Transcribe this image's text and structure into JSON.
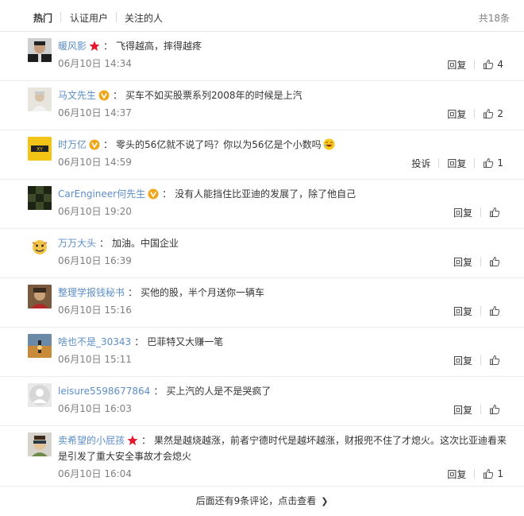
{
  "tabs": {
    "hot": "热门",
    "verified": "认证用户",
    "following": "关注的人",
    "total": "共18条"
  },
  "colors": {
    "username": "#eb7350",
    "username_blue": "#5c8ec8",
    "badge_gold": "#f0a71a",
    "badge_red": "#e6162d",
    "muted": "#808080"
  },
  "comments": [
    {
      "user": "暖风影",
      "badge": "red-star-icon",
      "text": "飞得越高，摔得越疼",
      "time": "06月10日 14:34",
      "report": "",
      "reply": "回复",
      "likes": "4"
    },
    {
      "user": "马文先生",
      "badge": "gold-v-icon",
      "text": "买车不如买股票系列2008年的时候是上汽",
      "time": "06月10日 14:37",
      "report": "",
      "reply": "回复",
      "likes": "2"
    },
    {
      "user": "时万亿",
      "badge": "gold-v-icon",
      "text": "零头的56亿就不说了吗？你以为56亿是个小数吗",
      "time": "06月10日 14:59",
      "report": "投诉",
      "reply": "回复",
      "likes": "1"
    },
    {
      "user": "CarEngineer何先生",
      "badge": "gold-v-icon",
      "text": "没有人能挡住比亚迪的发展了，除了他自己",
      "time": "06月10日 19:20",
      "report": "",
      "reply": "回复",
      "likes": ""
    },
    {
      "user": "万万大头",
      "badge": "",
      "text": "加油。中国企业",
      "time": "06月10日 16:39",
      "report": "",
      "reply": "回复",
      "likes": ""
    },
    {
      "user": "整理学报钱秘书",
      "badge": "",
      "text": "买他的股，半个月送你一辆车",
      "time": "06月10日 15:16",
      "report": "",
      "reply": "回复",
      "likes": ""
    },
    {
      "user": "啥也不是_30343",
      "badge": "",
      "text": "巴菲特又大赚一笔",
      "time": "06月10日 15:11",
      "report": "",
      "reply": "回复",
      "likes": ""
    },
    {
      "user": "leisure5598677864",
      "badge": "",
      "text": "买上汽的人是不是哭疯了",
      "time": "06月10日 16:03",
      "report": "",
      "reply": "回复",
      "likes": ""
    },
    {
      "user": "卖希望的小屁孩",
      "badge": "red-star-icon",
      "text": "果然是越烧越涨，前者宁德时代是越坏越涨，财报兜不住了才熄火。这次比亚迪看来是引发了重大安全事故才会熄火",
      "time": "06月10日 16:04",
      "report": "",
      "reply": "回复",
      "likes": "1"
    }
  ],
  "footer": {
    "more_text": "后面还有9条评论，点击查看"
  }
}
